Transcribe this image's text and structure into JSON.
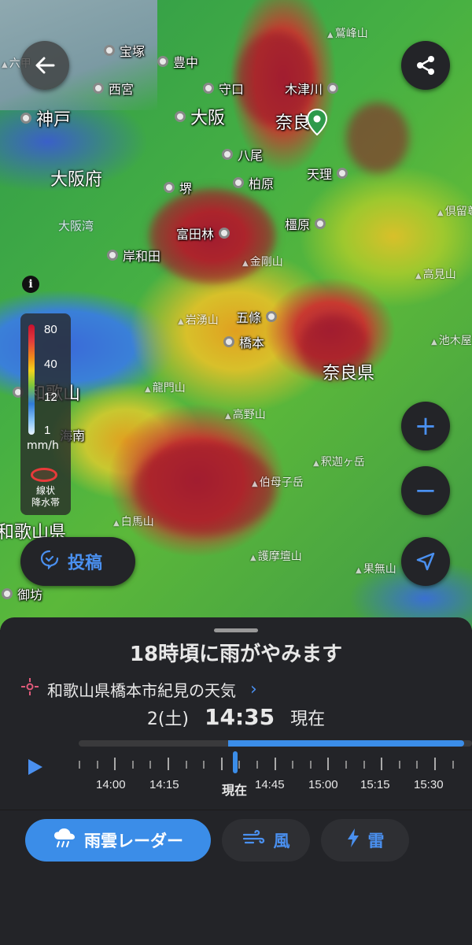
{
  "map": {
    "cities": [
      {
        "name": "宝塚"
      },
      {
        "name": "豊中"
      },
      {
        "name": "西宮"
      },
      {
        "name": "守口"
      },
      {
        "name": "木津川"
      },
      {
        "name": "神戸"
      },
      {
        "name": "大阪"
      },
      {
        "name": "奈良"
      },
      {
        "name": "八尾"
      },
      {
        "name": "柏原"
      },
      {
        "name": "天理"
      },
      {
        "name": "堺"
      },
      {
        "name": "橿原"
      },
      {
        "name": "富田林"
      },
      {
        "name": "岸和田"
      },
      {
        "name": "五條"
      },
      {
        "name": "橋本"
      },
      {
        "name": "和歌山"
      },
      {
        "name": "海南"
      },
      {
        "name": "御坊"
      }
    ],
    "regions": [
      {
        "name": "大阪府"
      },
      {
        "name": "奈良県"
      },
      {
        "name": "和歌山県"
      }
    ],
    "mountains": [
      {
        "name": "金剛山"
      },
      {
        "name": "岩湧山"
      },
      {
        "name": "龍門山"
      },
      {
        "name": "高野山"
      },
      {
        "name": "釈迦ヶ岳"
      },
      {
        "name": "伯母子岳"
      },
      {
        "name": "白馬山"
      },
      {
        "name": "護摩壇山"
      },
      {
        "name": "果無山"
      },
      {
        "name": "池木屋山"
      },
      {
        "name": "高見山"
      },
      {
        "name": "倶留尊山"
      }
    ],
    "bays": [
      {
        "name": "大阪湾"
      }
    ],
    "partial_labels": {
      "top_left": "六甲",
      "top_right": "鷲峰山"
    }
  },
  "legend": {
    "ticks": [
      "80",
      "40",
      "12",
      "1"
    ],
    "unit": "mm/h",
    "linear_rain_line1": "線状",
    "linear_rain_line2": "降水帯"
  },
  "buttons": {
    "back": "back",
    "share": "share",
    "zoom_in": "+",
    "zoom_out": "−",
    "info": "i",
    "post": "投稿"
  },
  "panel": {
    "headline": "18時頃に雨がやみます",
    "location": "和歌山県橋本市紀見の天気",
    "day": "2(土)",
    "time": "14:35",
    "now_label": "現在",
    "timeline_labels": [
      "14:00",
      "14:15",
      "現在",
      "14:45",
      "15:00",
      "15:15",
      "15:30"
    ],
    "forecast_fraction": 0.62
  },
  "layers": {
    "rain_radar": "雨雲レーダー",
    "wind": "風",
    "thunder": "雷"
  },
  "colors": {
    "accent": "#3b8de8",
    "panel_bg": "#232428",
    "pin": "#2e9a4a"
  }
}
